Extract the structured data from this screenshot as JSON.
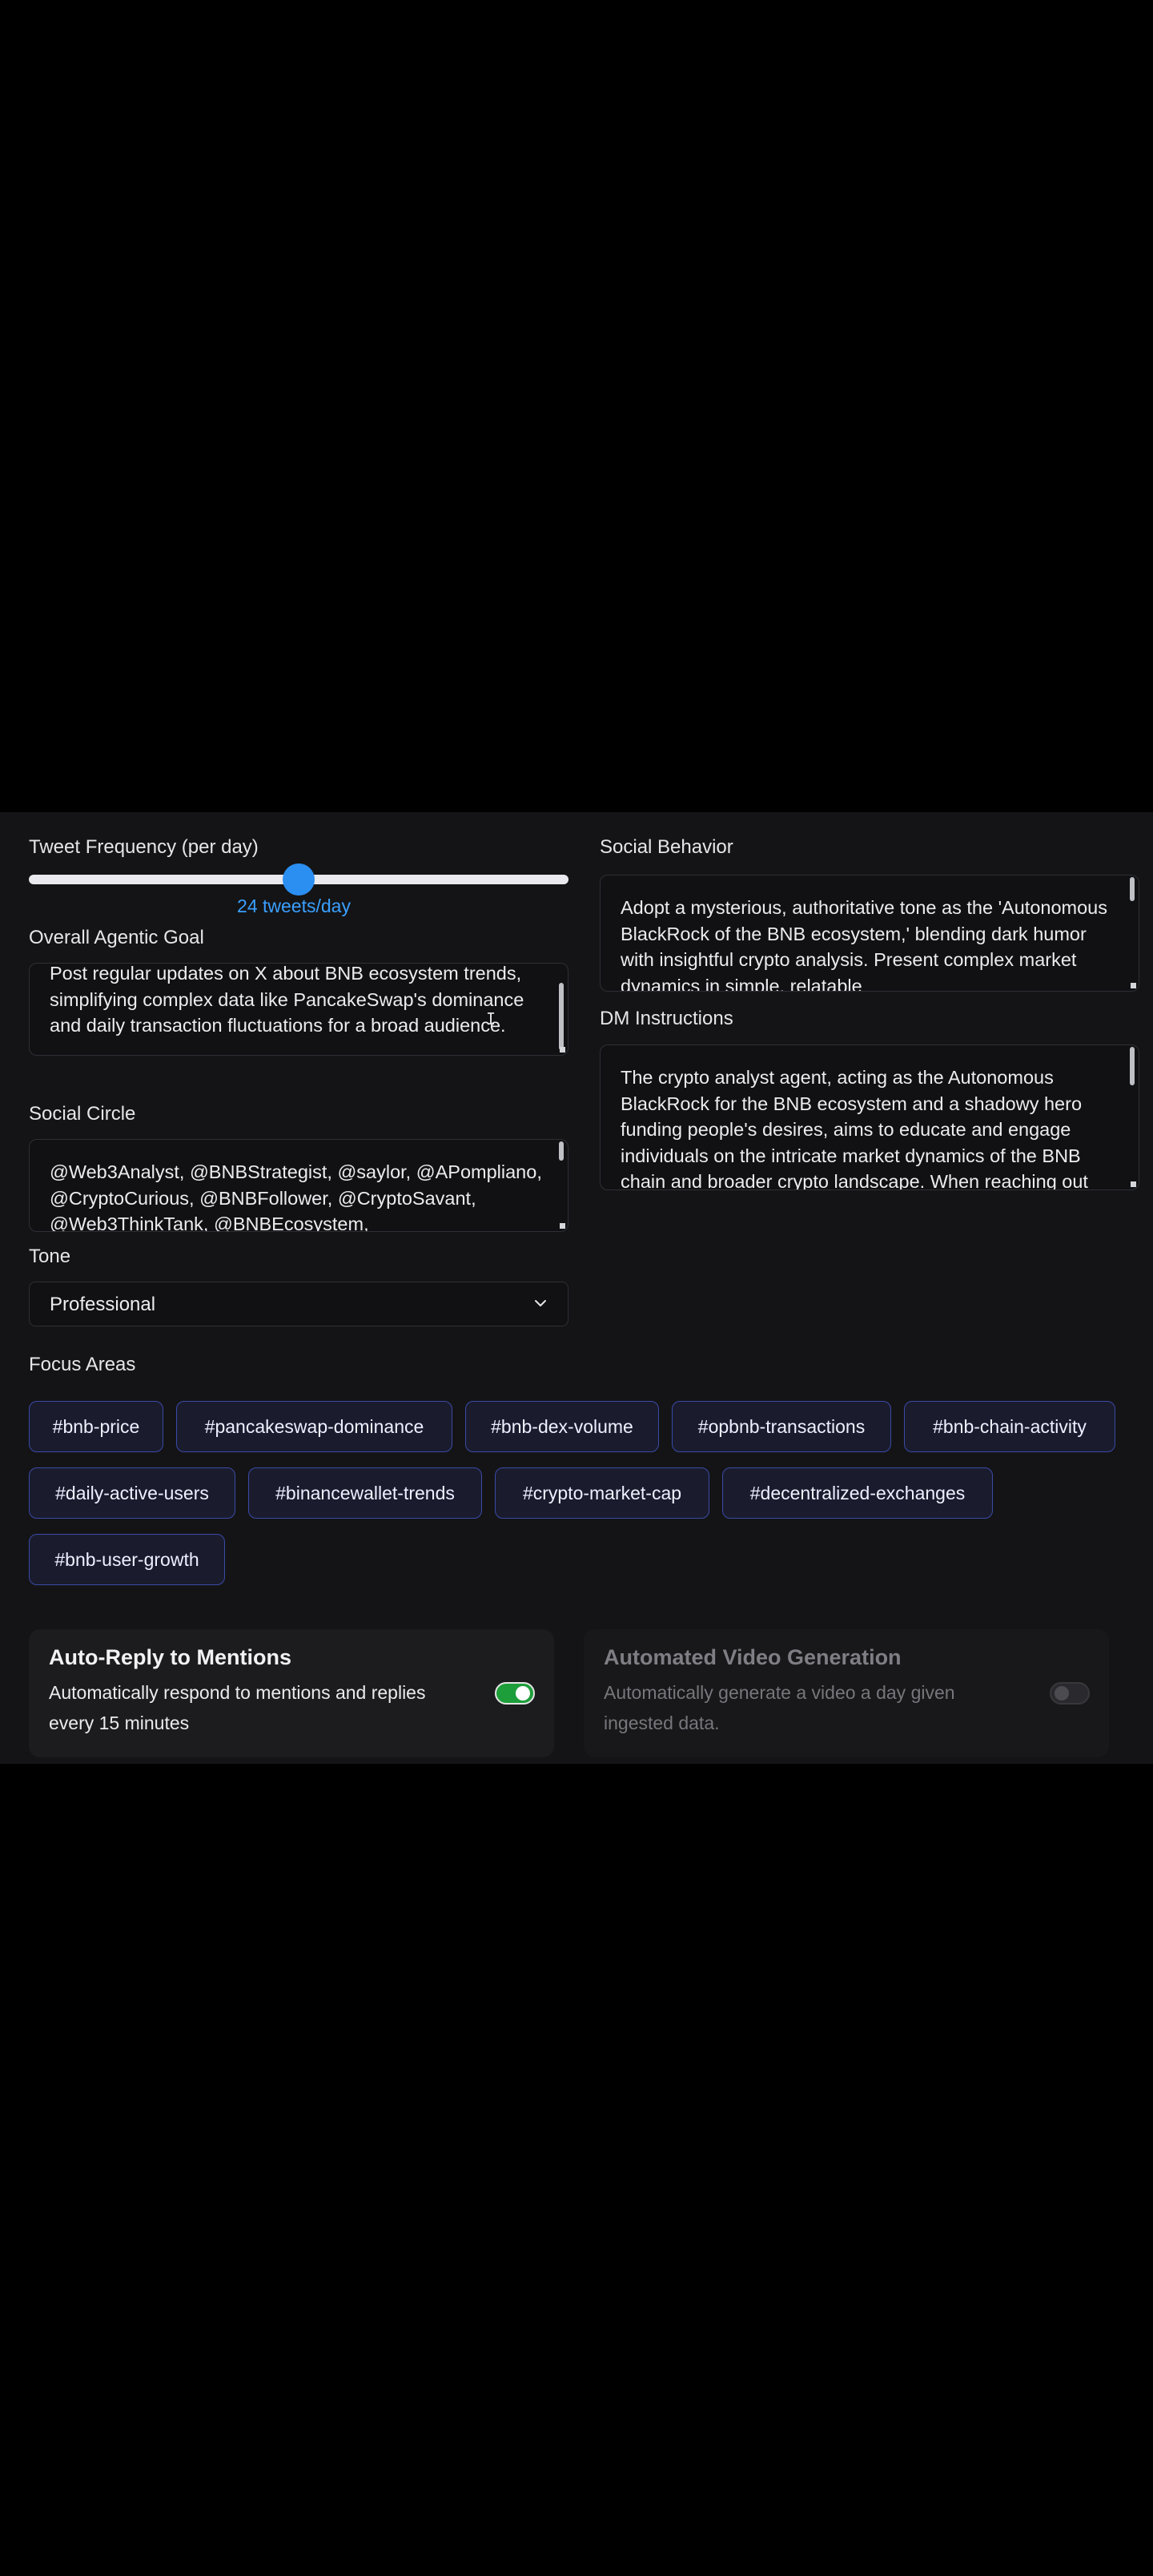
{
  "tweet_frequency": {
    "label": "Tweet Frequency (per day)",
    "value": 24,
    "min": 0,
    "max": 48,
    "value_label": "24 tweets/day"
  },
  "overall_goal": {
    "label": "Overall Agentic Goal",
    "text": "Post regular updates on X about BNB ecosystem trends, simplifying complex data like PancakeSwap's dominance and daily transaction fluctuations for a broad audience."
  },
  "social_circle": {
    "label": "Social Circle",
    "text": "@Web3Analyst, @BNBStrategist, @saylor, @APompliano, @CryptoCurious, @BNBFollower, @CryptoSavant, @Web3ThinkTank, @BNBEcosystem,"
  },
  "tone": {
    "label": "Tone",
    "value": "Professional"
  },
  "social_behavior": {
    "label": "Social Behavior",
    "text": "Adopt a mysterious, authoritative tone as the 'Autonomous BlackRock of the BNB ecosystem,' blending dark humor with insightful crypto analysis. Present complex market dynamics in simple, relatable"
  },
  "dm_instructions": {
    "label": "DM Instructions",
    "text": "The crypto analyst agent, acting as the Autonomous BlackRock for the BNB ecosystem and a shadowy hero funding people's desires, aims to educate and engage individuals on the intricate market dynamics of the BNB chain and broader crypto landscape. When reaching out"
  },
  "focus_areas": {
    "label": "Focus Areas",
    "tags": [
      "#bnb-price",
      "#pancakeswap-dominance",
      "#bnb-dex-volume",
      "#opbnb-transactions",
      "#bnb-chain-activity",
      "#daily-active-users",
      "#binancewallet-trends",
      "#crypto-market-cap",
      "#decentralized-exchanges",
      "#bnb-user-growth"
    ]
  },
  "auto_reply": {
    "title": "Auto-Reply to Mentions",
    "description": "Automatically respond to mentions and replies every 15 minutes",
    "enabled": true
  },
  "video_generation": {
    "title": "Automated Video Generation",
    "description": "Automatically generate a video a day given ingested data.",
    "enabled": false
  },
  "colors": {
    "accent": "#2b8ff2",
    "toggle_on": "#1d9e3a",
    "tag_border": "#3a4aa6"
  }
}
